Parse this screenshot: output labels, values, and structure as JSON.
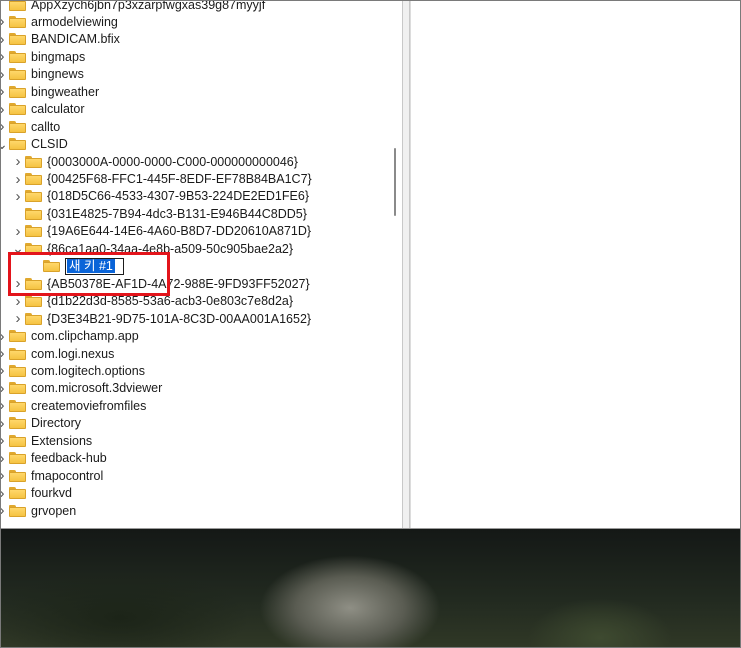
{
  "tree": {
    "items": [
      {
        "label": "AppXzych6jbn7p3xzarpfwgxas39g87myyjf",
        "level": 0,
        "expander": "none"
      },
      {
        "label": "armodelviewing",
        "level": 0,
        "expander": "collapsed"
      },
      {
        "label": "BANDICAM.bfix",
        "level": 0,
        "expander": "collapsed"
      },
      {
        "label": "bingmaps",
        "level": 0,
        "expander": "collapsed"
      },
      {
        "label": "bingnews",
        "level": 0,
        "expander": "collapsed"
      },
      {
        "label": "bingweather",
        "level": 0,
        "expander": "collapsed"
      },
      {
        "label": "calculator",
        "level": 0,
        "expander": "collapsed"
      },
      {
        "label": "callto",
        "level": 0,
        "expander": "collapsed"
      },
      {
        "label": "CLSID",
        "level": 0,
        "expander": "expanded"
      },
      {
        "label": "{0003000A-0000-0000-C000-000000000046}",
        "level": 1,
        "expander": "collapsed"
      },
      {
        "label": "{00425F68-FFC1-445F-8EDF-EF78B84BA1C7}",
        "level": 1,
        "expander": "collapsed"
      },
      {
        "label": "{018D5C66-4533-4307-9B53-224DE2ED1FE6}",
        "level": 1,
        "expander": "collapsed"
      },
      {
        "label": "{031E4825-7B94-4dc3-B131-E946B44C8DD5}",
        "level": 1,
        "expander": "none"
      },
      {
        "label": "{19A6E644-14E6-4A60-B8D7-DD20610A871D}",
        "level": 1,
        "expander": "collapsed"
      },
      {
        "label": "{86ca1aa0-34aa-4e8b-a509-50c905bae2a2}",
        "level": 1,
        "expander": "expanded"
      },
      {
        "label": "새 키 #1",
        "level": 2,
        "expander": "none",
        "editing": true
      },
      {
        "label": "{AB50378E-AF1D-4A72-988E-9FD93FF52027}",
        "level": 1,
        "expander": "collapsed"
      },
      {
        "label": "{d1b22d3d-8585-53a6-acb3-0e803c7e8d2a}",
        "level": 1,
        "expander": "collapsed"
      },
      {
        "label": "{D3E34B21-9D75-101A-8C3D-00AA001A1652}",
        "level": 1,
        "expander": "collapsed"
      },
      {
        "label": "com.clipchamp.app",
        "level": 0,
        "expander": "collapsed"
      },
      {
        "label": "com.logi.nexus",
        "level": 0,
        "expander": "collapsed"
      },
      {
        "label": "com.logitech.options",
        "level": 0,
        "expander": "collapsed"
      },
      {
        "label": "com.microsoft.3dviewer",
        "level": 0,
        "expander": "collapsed"
      },
      {
        "label": "createmoviefromfiles",
        "level": 0,
        "expander": "collapsed"
      },
      {
        "label": "Directory",
        "level": 0,
        "expander": "collapsed"
      },
      {
        "label": "Extensions",
        "level": 0,
        "expander": "collapsed"
      },
      {
        "label": "feedback-hub",
        "level": 0,
        "expander": "collapsed"
      },
      {
        "label": "fmapocontrol",
        "level": 0,
        "expander": "collapsed"
      },
      {
        "label": "fourkvd",
        "level": 0,
        "expander": "collapsed"
      },
      {
        "label": "grvopen",
        "level": 0,
        "expander": "collapsed"
      }
    ]
  },
  "colors": {
    "highlight_box": "#e3141b",
    "selection": "#0a64d8",
    "folder": "#f5c343"
  },
  "icons": {
    "folder": "folder-icon",
    "expander_collapsed": "chevron-right-icon",
    "expander_expanded": "chevron-down-icon"
  }
}
